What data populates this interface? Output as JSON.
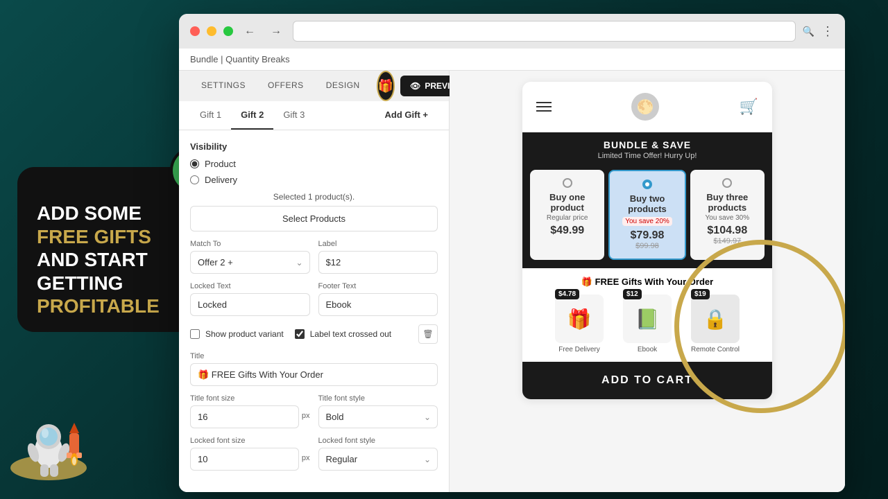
{
  "background": {
    "color": "#062e2e"
  },
  "left_card": {
    "headline_line1": "ADD SOME",
    "headline_line2_gold": "FREE GIFTS",
    "headline_line3": "AND START",
    "headline_line4": "GETTING",
    "headline_line5_gold": "PROFITABLE"
  },
  "browser": {
    "breadcrumb": "Bundle | Quantity Breaks",
    "main_tabs": [
      {
        "label": "SETTINGS",
        "active": false
      },
      {
        "label": "OFFERS",
        "active": false
      },
      {
        "label": "DESIGN",
        "active": false
      },
      {
        "label": "🎁",
        "active": true,
        "icon": true
      }
    ],
    "preview_btn": "PREVIEW",
    "sub_tabs": [
      {
        "label": "Gift 1",
        "active": false
      },
      {
        "label": "Gift 2",
        "active": true
      },
      {
        "label": "Gift 3",
        "active": false
      },
      {
        "label": "Add Gift +",
        "active": false
      }
    ],
    "visibility_label": "Visibility",
    "visibility_options": [
      {
        "label": "Product",
        "selected": true
      },
      {
        "label": "Delivery",
        "selected": false
      }
    ],
    "selected_products_info": "Selected 1 product(s).",
    "select_products_btn": "Select Products",
    "match_to_label": "Match To",
    "match_to_value": "Offer 2 +",
    "label_label": "Label",
    "label_value": "$12",
    "locked_text_label": "Locked Text",
    "locked_text_value": "Locked",
    "footer_text_label": "Footer Text",
    "footer_text_value": "Ebook",
    "show_variant_label": "Show product variant",
    "label_crossed_label": "Label text crossed out",
    "title_section_label": "Title",
    "title_value": "🎁 FREE Gifts With Your Order",
    "title_font_size_label": "Title font size",
    "title_font_size_value": "16",
    "title_font_size_unit": "px",
    "title_font_style_label": "Title font style",
    "title_font_style_value": "Bold",
    "locked_font_size_label": "Locked font size",
    "locked_font_style_label": "Locked font style"
  },
  "preview": {
    "store_logo": "🌕",
    "bundle_title": "BUNDLE & SAVE",
    "bundle_subtitle": "Limited Time Offer! Hurry Up!",
    "offers": [
      {
        "title": "Buy one product",
        "badge": "Regular price",
        "price": "$49.99",
        "original": "",
        "selected": false
      },
      {
        "title": "Buy two products",
        "badge": "You save 20%",
        "price": "$79.98",
        "original": "$99.98",
        "selected": true
      },
      {
        "title": "Buy three products",
        "badge": "You save 30%",
        "price": "$104.98",
        "original": "$149.97",
        "selected": false
      }
    ],
    "free_gifts_title": "🎁 FREE Gifts With Your Order",
    "gift_items": [
      {
        "name": "Free Delivery",
        "price": "$4.78",
        "emoji": "🎁"
      },
      {
        "name": "Ebook",
        "price": "$12",
        "emoji": "📘"
      },
      {
        "name": "Remote Control",
        "price": "$19",
        "emoji": "🔒"
      }
    ],
    "add_to_cart_btn": "ADD TO CART"
  }
}
